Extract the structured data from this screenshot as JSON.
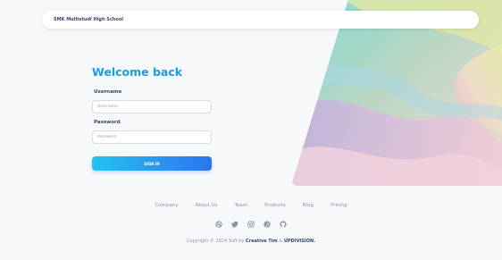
{
  "header": {
    "brand": "SMK Multistudi High School"
  },
  "login": {
    "title": "Welcome back",
    "username_label": "Username",
    "username_placeholder": "Username",
    "password_label": "Password",
    "password_placeholder": "Password",
    "signin_label": "SIGN IN"
  },
  "footer": {
    "links": [
      "Company",
      "About Us",
      "Team",
      "Products",
      "Blog",
      "Pricing"
    ],
    "socials": [
      "dribbble-icon",
      "twitter-icon",
      "instagram-icon",
      "pinterest-icon",
      "github-icon"
    ],
    "copyright_prefix": "Copyright © 2024 Soft by",
    "copyright_author": "Creative Tim",
    "copyright_mid": "&",
    "copyright_company": "UPDIVISION."
  },
  "colors": {
    "accent": "#1a9be6",
    "button_start": "#22c3f0",
    "button_end": "#2d74f0",
    "background": "#f7f8fa"
  }
}
